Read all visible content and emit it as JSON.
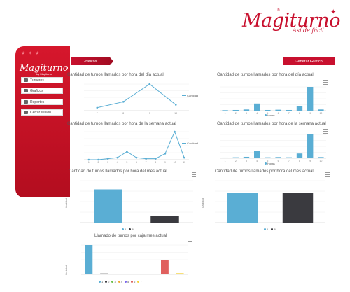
{
  "brand": {
    "name": "Magiturno",
    "tagline": "Así de fácil",
    "sidebar_sub": "by Magiturno",
    "color": "#c8102e"
  },
  "sidebar": {
    "items": [
      {
        "label": "Turneros",
        "icon": "list-icon"
      },
      {
        "label": "Graficos",
        "icon": "bar-chart-icon"
      },
      {
        "label": "Reportes",
        "icon": "document-icon"
      },
      {
        "label": "Cerrar sesion",
        "icon": "logout-icon"
      }
    ]
  },
  "header": {
    "tab_label": "Graficos",
    "generate_button": "Generar Grafico"
  },
  "charts": {
    "c1": {
      "title": "Cantidad de turnos llamados por hora del día actual",
      "legend": "Cantidad"
    },
    "c2": {
      "title": "Cantidad de turnos llamados por hora del día actual",
      "legend": "Horas"
    },
    "c3": {
      "title": "Cantidad de turnos llamados por hora de la semana actual",
      "legend": "Cantidad"
    },
    "c4": {
      "title": "Cantidad de turnos llamados por hora de la semana actual",
      "legend": "Horas"
    },
    "c5": {
      "title": "Cantidad de turnos llamados por hora del mes actual",
      "ylabel": "Cantidad",
      "legend": [
        "1",
        "6"
      ]
    },
    "c6": {
      "title": "Cantidad de turnos llamados por hora del mes actual",
      "ylabel": "Cantidad",
      "legend": [
        "1",
        "6"
      ]
    },
    "c7": {
      "title": "Llamado de turnos por caja mes actual",
      "ylabel": "Cantidad",
      "legend": [
        "1",
        "2",
        "3",
        "4",
        "5",
        "6",
        "7"
      ]
    }
  },
  "chart_data": [
    {
      "type": "line",
      "title": "Cantidad de turnos llamados por hora del día actual",
      "x": [
        "7",
        "8",
        "9",
        "10"
      ],
      "series": [
        {
          "name": "Cantidad",
          "values": [
            1,
            3,
            9,
            2
          ]
        }
      ],
      "color": "#5aaed4"
    },
    {
      "type": "bar",
      "title": "Cantidad de turnos llamados por hora del día actual",
      "categories": [
        "1",
        "2",
        "3",
        "4",
        "5",
        "6",
        "7",
        "8",
        "9",
        "10"
      ],
      "series": [
        {
          "name": "Horas",
          "values": [
            0.2,
            0.3,
            0.5,
            3,
            0.3,
            0.4,
            0.3,
            2,
            10,
            0.5
          ]
        }
      ],
      "color": "#5aaed4"
    },
    {
      "type": "line",
      "title": "Cantidad de turnos llamados por hora de la semana actual",
      "x": [
        "1",
        "2",
        "3",
        "4",
        "5",
        "6",
        "7",
        "8",
        "9",
        "10",
        "11"
      ],
      "series": [
        {
          "name": "Cantidad",
          "values": [
            0,
            0,
            0.5,
            1,
            4,
            1,
            0.5,
            0.5,
            3,
            14,
            1
          ]
        }
      ],
      "color": "#5aaed4"
    },
    {
      "type": "bar",
      "title": "Cantidad de turnos llamados por hora de la semana actual",
      "categories": [
        "1",
        "2",
        "3",
        "4",
        "5",
        "6",
        "7",
        "8",
        "9",
        "10"
      ],
      "series": [
        {
          "name": "Horas",
          "values": [
            0.3,
            0.4,
            0.6,
            3,
            0.4,
            0.5,
            0.4,
            2,
            10,
            0.5
          ]
        }
      ],
      "color": "#5aaed4"
    },
    {
      "type": "bar",
      "title": "Cantidad de turnos llamados por hora del mes actual",
      "categories": [
        "1",
        "6"
      ],
      "values": [
        95,
        20
      ],
      "colors": [
        "#5aaed4",
        "#3a3a3f"
      ],
      "ylabel": "Cantidad"
    },
    {
      "type": "bar",
      "title": "Cantidad de turnos llamados por hora del mes actual",
      "categories": [
        "1",
        "6"
      ],
      "values": [
        85,
        85
      ],
      "colors": [
        "#5aaed4",
        "#3a3a3f"
      ],
      "ylabel": "Cantidad"
    },
    {
      "type": "bar",
      "title": "Llamado de turnos por caja mes actual",
      "categories": [
        "1",
        "2",
        "3",
        "4",
        "5",
        "6",
        "7"
      ],
      "values": [
        100,
        3,
        1,
        1,
        2,
        50,
        4
      ],
      "colors": [
        "#5aaed4",
        "#3a3a3f",
        "#6cc24a",
        "#f0a830",
        "#7b68ee",
        "#e0605e",
        "#f5d13a"
      ],
      "ylabel": "Cantidad"
    }
  ]
}
